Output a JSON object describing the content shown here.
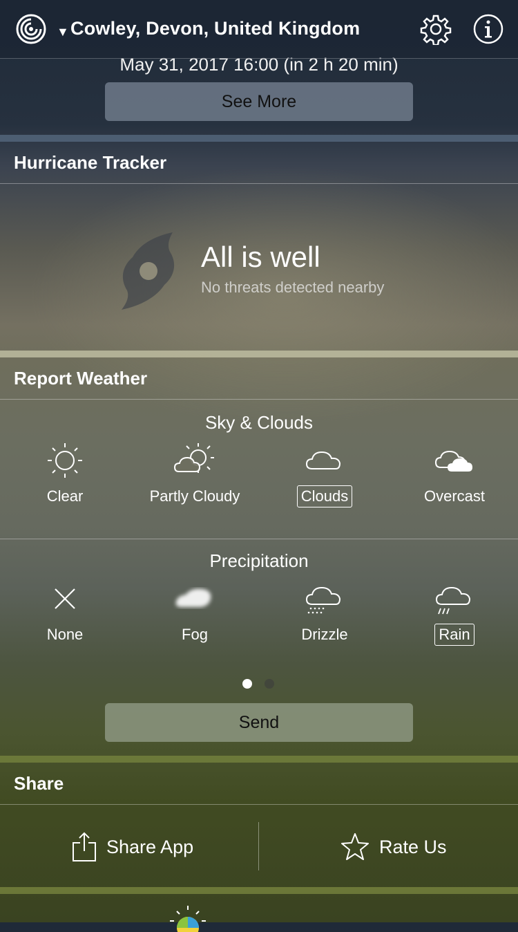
{
  "header": {
    "location": "Cowley, Devon, United Kingdom",
    "icons": [
      "app-logo-icon",
      "dropdown-arrow-icon",
      "gear-icon",
      "info-icon"
    ]
  },
  "forecast": {
    "date_line": "May 31, 2017 16:00 (in 2 h 20 min)",
    "see_more_label": "See More"
  },
  "hurricane": {
    "title": "Hurricane Tracker",
    "status": "All is well",
    "status_detail": "No threats detected nearby"
  },
  "report": {
    "title": "Report Weather",
    "sky": {
      "title": "Sky & Clouds",
      "options": [
        {
          "label": "Clear",
          "icon": "sun-icon"
        },
        {
          "label": "Partly Cloudy",
          "icon": "partly-cloudy-icon"
        },
        {
          "label": "Clouds",
          "icon": "cloud-icon",
          "selected": true
        },
        {
          "label": "Overcast",
          "icon": "overcast-icon"
        }
      ]
    },
    "precipitation": {
      "title": "Precipitation",
      "options": [
        {
          "label": "None",
          "icon": "x-icon"
        },
        {
          "label": "Fog",
          "icon": "fog-icon"
        },
        {
          "label": "Drizzle",
          "icon": "drizzle-icon"
        },
        {
          "label": "Rain",
          "icon": "rain-icon",
          "selected": true
        }
      ]
    },
    "page_indicator": {
      "current": 1,
      "total": 2
    },
    "send_label": "Send"
  },
  "share": {
    "title": "Share",
    "share_app_label": "Share App",
    "rate_us_label": "Rate Us"
  },
  "colors": {
    "accent_bar_top": "#52657a",
    "accent_bar_mid": "#b9b89c",
    "accent_bar_bottom": "#6e7a3a"
  }
}
